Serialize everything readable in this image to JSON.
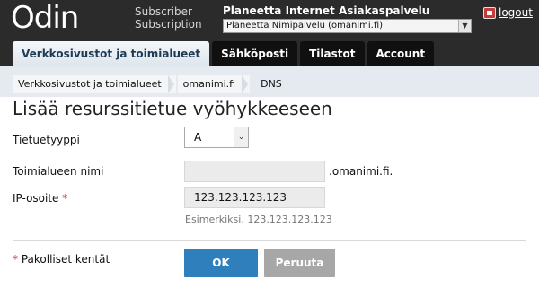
{
  "header": {
    "logo": "Odin",
    "subscriber_label": "Subscriber",
    "subscription_label": "Subscription",
    "subscriber_name": "Planeetta Internet Asiakaspalvelu",
    "subscription_value": "Planeetta Nimipalvelu (omanimi.fi)",
    "logout_label": "logout"
  },
  "tabs": [
    {
      "label": "Verkkosivustot ja toimialueet",
      "active": true
    },
    {
      "label": "Sähköposti",
      "active": false
    },
    {
      "label": "Tilastot",
      "active": false
    },
    {
      "label": "Account",
      "active": false
    }
  ],
  "breadcrumbs": [
    "Verkkosivustot ja toimialueet",
    "omanimi.fi",
    "DNS"
  ],
  "page_title": "Lisää resurssitietue vyöhykkeeseen",
  "form": {
    "record_type_label": "Tietuetyyppi",
    "record_type_value": "A",
    "domain_name_label": "Toimialueen nimi",
    "domain_name_value": "",
    "domain_suffix": ".omanimi.fi.",
    "ip_label": "IP-osoite",
    "required_mark": "*",
    "ip_value": "123.123.123.123",
    "ip_hint": "Esimerkiksi, 123.123.123.123",
    "required_note": "Pakolliset kentät",
    "ok_label": "OK",
    "cancel_label": "Peruuta"
  },
  "colors": {
    "header_bg": "#2b2b2b",
    "accent": "#2f7fbd",
    "required": "#c0392b"
  }
}
